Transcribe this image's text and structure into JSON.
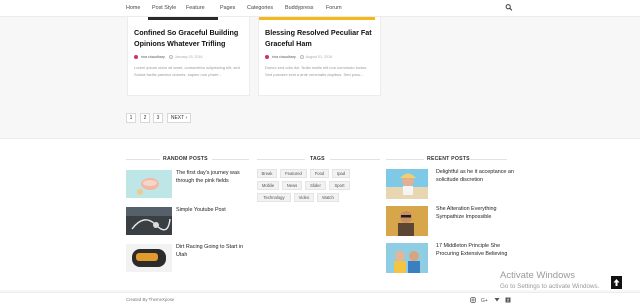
{
  "nav": {
    "items": [
      "Home",
      "Post Style",
      "Feature",
      "Pages",
      "Categories",
      "Buddypress",
      "Forum"
    ],
    "search_icon": "search-icon"
  },
  "cards": [
    {
      "title": "Confined So Graceful Building Opinions Whatever Trifling",
      "author": "rina chaudhary",
      "date": "January 03, 2016",
      "excerpt": "Lorem ipsum dolor sit amet, consectetur adipisicing elit, sed Soluta facilis pariatur dolores, sapien non phare...",
      "strip_color": "#2a2a2a"
    },
    {
      "title": "Blessing Resolved Peculiar Fat Graceful Ham",
      "author": "rina chaudhary",
      "date": "August 01, 2016",
      "excerpt": "Donec sed odio dui. Nulla mollis elit non commodo luctus. Sed posuere erat a ante venenatis dapibus. Sed posu...",
      "strip_color": "#f5b81c"
    }
  ],
  "pagination": [
    "1",
    "2",
    "3",
    "NEXT ›"
  ],
  "widgets": {
    "random_posts_title": "RANDOM POSTS",
    "tags_title": "TAGS",
    "recent_posts_title": "RECENT POSTS",
    "random_posts": [
      {
        "title": "The first day's journey was through the pink fields"
      },
      {
        "title": "Simple Youtube Post"
      },
      {
        "title": "Dirt Racing Going to Start in Utah"
      }
    ],
    "tags": [
      "Break",
      "Featured",
      "Food",
      "Ipad",
      "Mobile",
      "News",
      "Slider",
      "Sport",
      "Technology",
      "Video",
      "Watch"
    ],
    "recent_posts": [
      {
        "title": "Delightful as he it acceptance an solicitude discretion"
      },
      {
        "title": "She Alteration Everything Sympathize Impossible"
      },
      {
        "title": "17 Middleton Principle She Procuring Extensive Believing"
      }
    ]
  },
  "watermark": {
    "title": "Activate Windows",
    "subtitle": "Go to Settings to activate Windows."
  },
  "footer": {
    "credit": "Created By ThemeXpose",
    "social_icons": [
      "instagram-icon",
      "google-plus-icon",
      "twitter-icon",
      "facebook-icon"
    ]
  },
  "colors": {
    "accent": "#f5b81c",
    "author_pink": "#d42f6a"
  }
}
